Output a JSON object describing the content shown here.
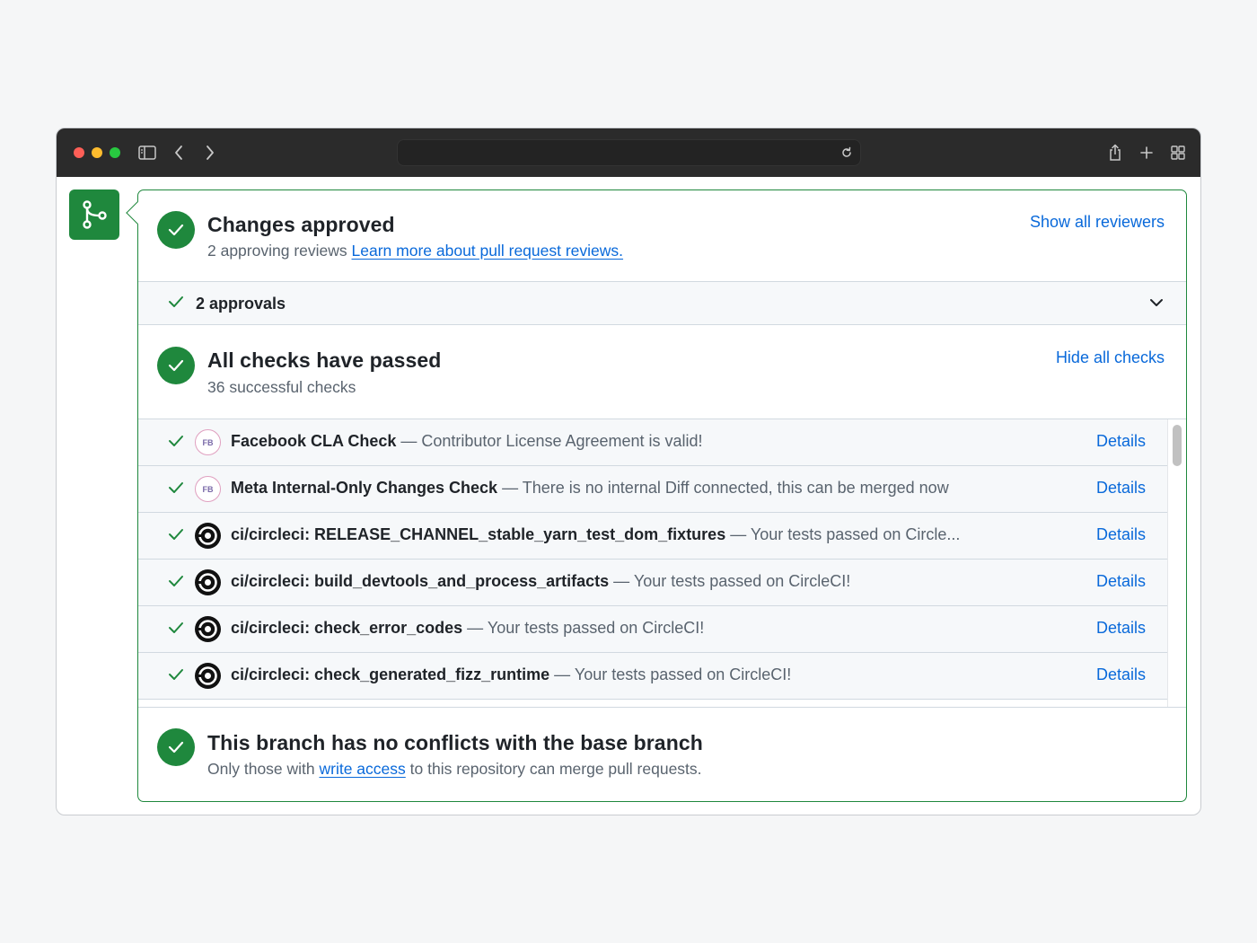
{
  "browser": {
    "toolbar_icons": [
      "sidebar-icon",
      "back-icon",
      "forward-icon",
      "reload-icon",
      "share-icon",
      "new-tab-icon",
      "tab-overview-icon"
    ],
    "url": ""
  },
  "colors": {
    "success": "#1f883d",
    "link": "#0969da",
    "muted": "#59636e"
  },
  "approved": {
    "title": "Changes approved",
    "subtitle": "2 approving reviews",
    "learn_link": "Learn more about pull request reviews.",
    "action": "Show all reviewers",
    "approvals_label": "2 approvals"
  },
  "checks": {
    "title": "All checks have passed",
    "subtitle": "36 successful checks",
    "action": "Hide all checks",
    "items": [
      {
        "logo": "fb",
        "logo_text": "FB",
        "name": "Facebook CLA Check",
        "desc": " — Contributor License Agreement is valid!",
        "details": "Details"
      },
      {
        "logo": "fb",
        "logo_text": "FB",
        "name": "Meta Internal-Only Changes Check",
        "desc": " — There is no internal Diff connected, this can be merged now",
        "details": "Details"
      },
      {
        "logo": "circleci",
        "name": "ci/circleci: RELEASE_CHANNEL_stable_yarn_test_dom_fixtures",
        "desc": " — Your tests passed on Circle...",
        "details": "Details"
      },
      {
        "logo": "circleci",
        "name": "ci/circleci: build_devtools_and_process_artifacts",
        "desc": " — Your tests passed on CircleCI!",
        "details": "Details"
      },
      {
        "logo": "circleci",
        "name": "ci/circleci: check_error_codes",
        "desc": " — Your tests passed on CircleCI!",
        "details": "Details"
      },
      {
        "logo": "circleci",
        "name": "ci/circleci: check_generated_fizz_runtime",
        "desc": " — Your tests passed on CircleCI!",
        "details": "Details"
      }
    ]
  },
  "merge": {
    "title": "This branch has no conflicts with the base branch",
    "subtitle_before": "Only those with ",
    "subtitle_link": "write access",
    "subtitle_after": " to this repository can merge pull requests."
  }
}
